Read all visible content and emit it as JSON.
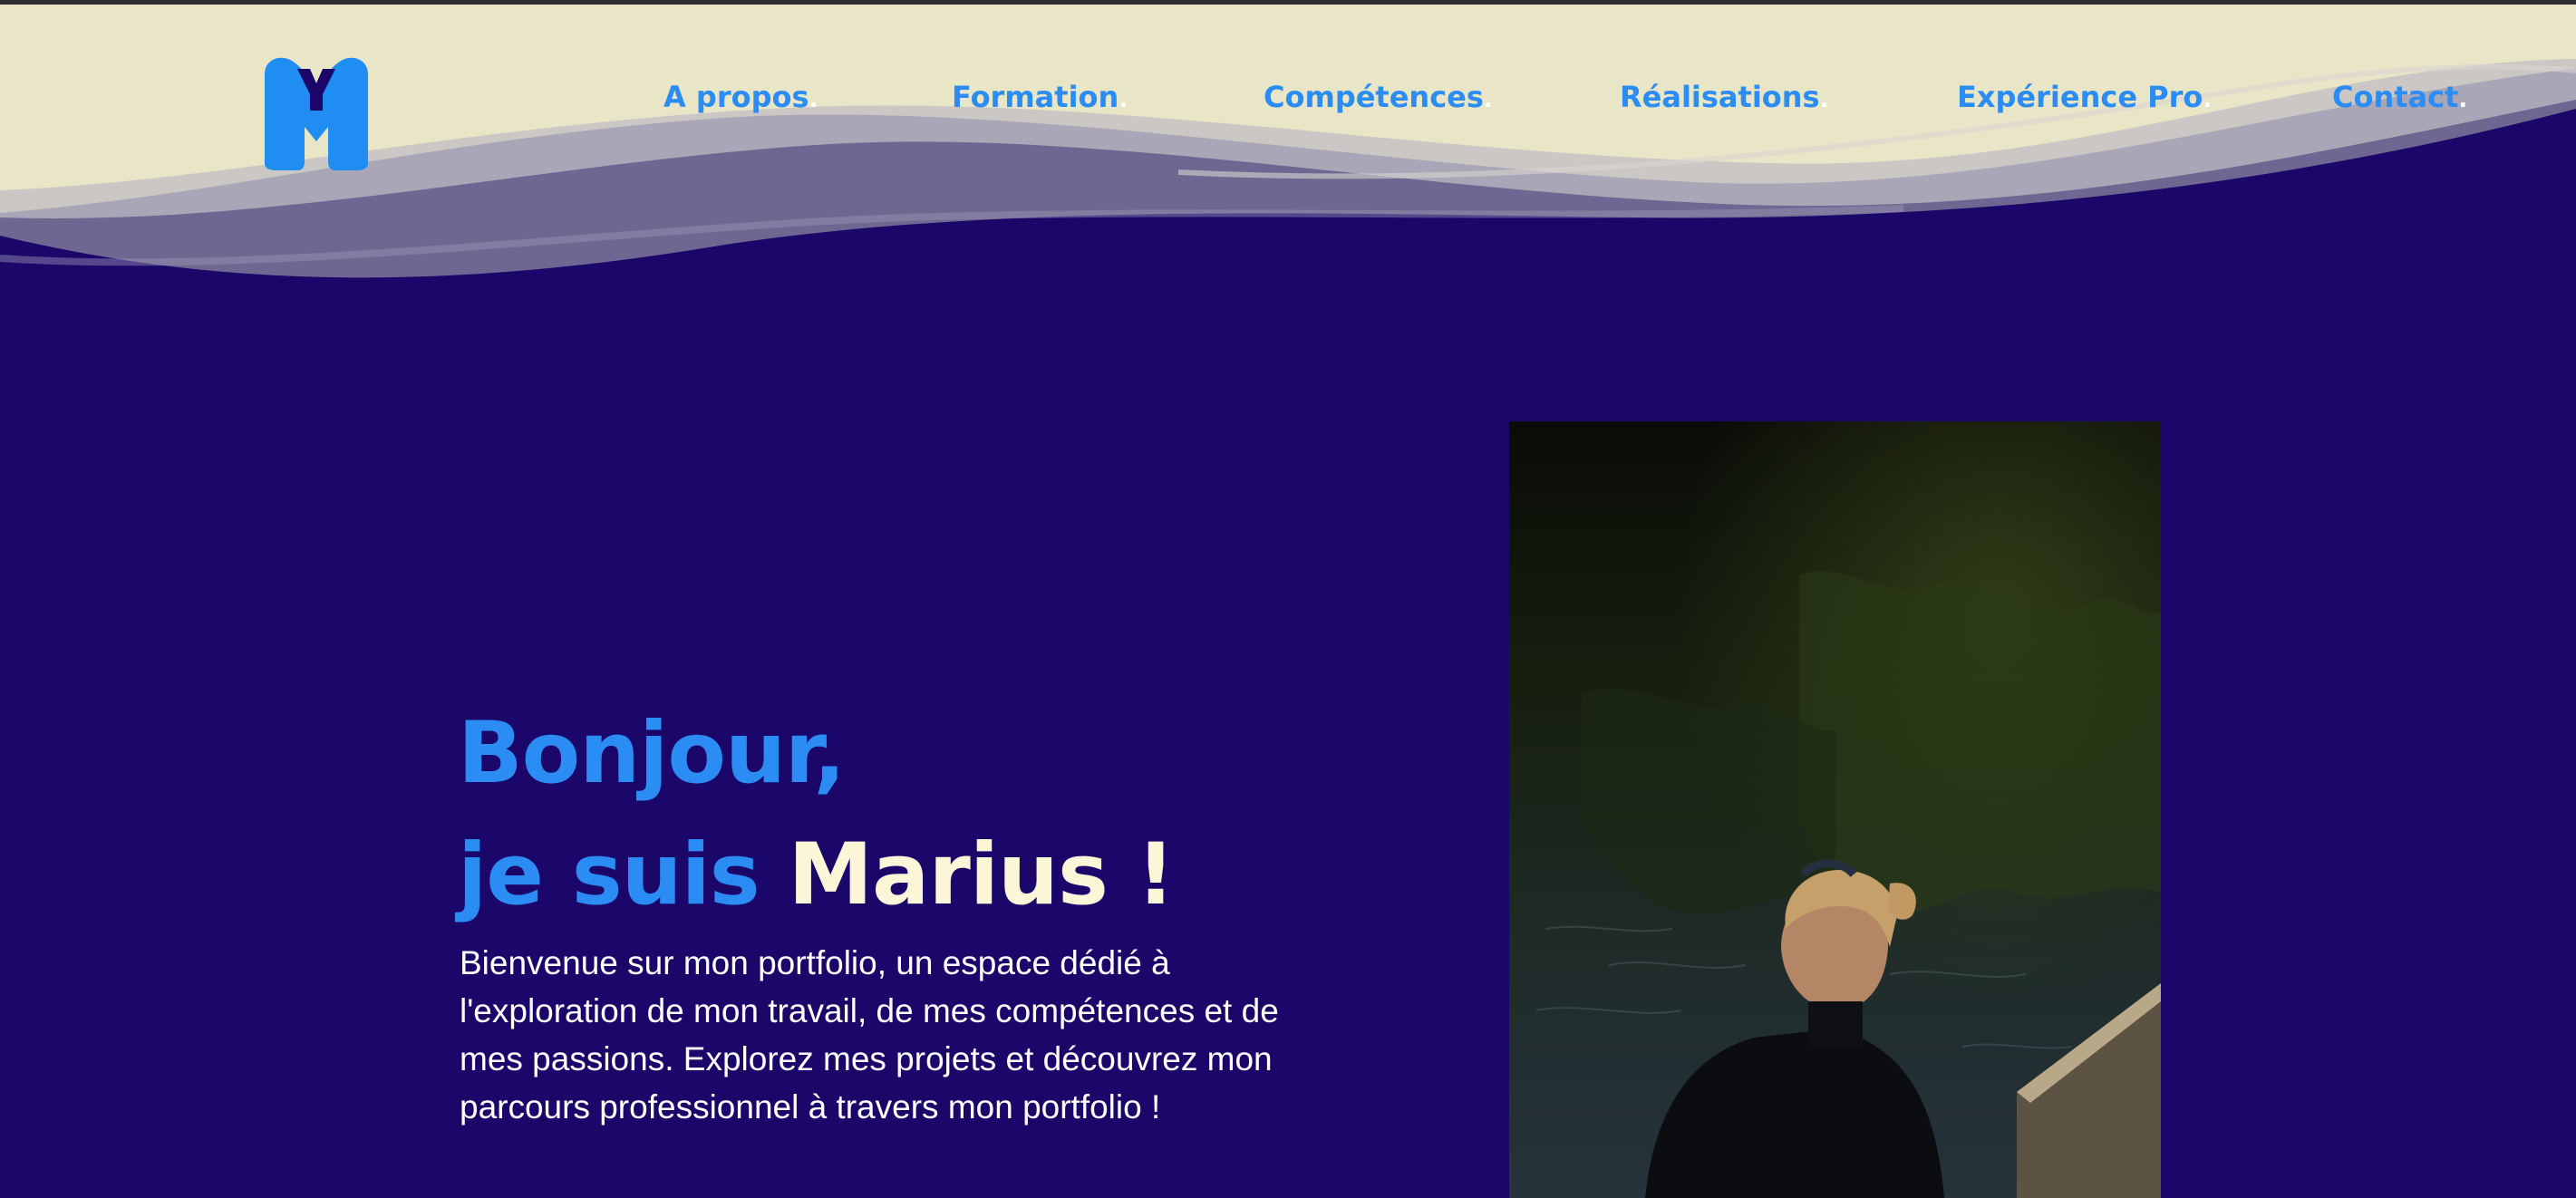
{
  "brand": {
    "logo_letters": "MY"
  },
  "nav": {
    "items": [
      {
        "label": "A propos",
        "dot": "."
      },
      {
        "label": "Formation",
        "dot": "."
      },
      {
        "label": "Compétences",
        "dot": "."
      },
      {
        "label": "Réalisations",
        "dot": "."
      },
      {
        "label": "Expérience Pro",
        "dot": "."
      },
      {
        "label": "Contact",
        "dot": "."
      }
    ]
  },
  "hero": {
    "line1": "Bonjour,",
    "line2_prefix": "je suis",
    "line2_name": "Marius !",
    "intro": "Bienvenue sur mon portfolio, un espace dédié à l'exploration de mon travail, de mes compétences et de mes passions. Explorez mes projets et découvrez mon parcours professionnel à travers mon portfolio !"
  },
  "colors": {
    "background": "#1b066a",
    "header_cream": "#e9e6c8",
    "accent_blue": "#2b8cf3",
    "name_cream": "#fbf6d8",
    "text_white": "#ffffff"
  },
  "icons": {
    "logo": "my-monogram-logo"
  }
}
